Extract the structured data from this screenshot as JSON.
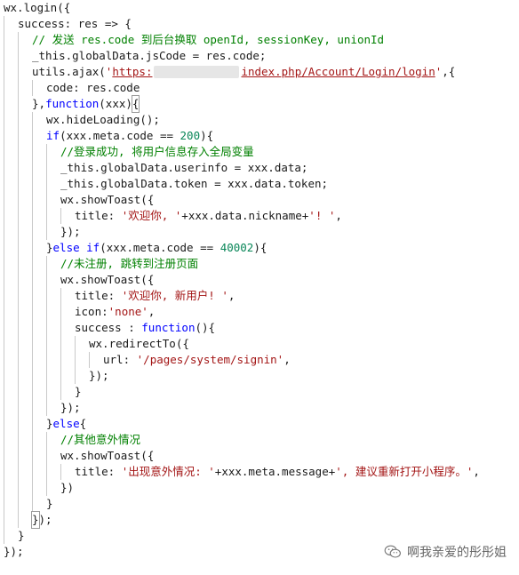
{
  "code_lines": [
    {
      "indent": 0,
      "tokens": [
        {
          "t": "wx.login({",
          "c": "plain"
        }
      ]
    },
    {
      "indent": 1,
      "tokens": [
        {
          "t": "success: res => {",
          "c": "plain"
        }
      ]
    },
    {
      "indent": 2,
      "tokens": [
        {
          "t": "// 发送 res.code 到后台换取 openId, sessionKey, unionId",
          "c": "com"
        }
      ]
    },
    {
      "indent": 2,
      "tokens": [
        {
          "t": "_this.globalData.jsCode = res.code;",
          "c": "plain"
        }
      ]
    },
    {
      "indent": 2,
      "tokens": [
        {
          "t": "utils.ajax(",
          "c": "plain"
        },
        {
          "t": "'",
          "c": "str"
        },
        {
          "t": "https:",
          "c": "link"
        },
        {
          "t": "",
          "c": "blur"
        },
        {
          "t": "index.php/Account/Login/login",
          "c": "link"
        },
        {
          "t": "'",
          "c": "str"
        },
        {
          "t": ",{",
          "c": "plain"
        }
      ]
    },
    {
      "indent": 3,
      "tokens": [
        {
          "t": "code: res.code",
          "c": "plain"
        }
      ]
    },
    {
      "indent": 2,
      "tokens": [
        {
          "t": "},",
          "c": "plain"
        },
        {
          "t": "function",
          "c": "kw"
        },
        {
          "t": "(xxx)",
          "c": "plain"
        },
        {
          "t": "{",
          "c": "bracket"
        }
      ]
    },
    {
      "indent": 3,
      "tokens": [
        {
          "t": "wx.hideLoading();",
          "c": "plain"
        }
      ]
    },
    {
      "indent": 3,
      "tokens": [
        {
          "t": "if",
          "c": "kw"
        },
        {
          "t": "(xxx.meta.code == ",
          "c": "plain"
        },
        {
          "t": "200",
          "c": "num"
        },
        {
          "t": "){",
          "c": "plain"
        }
      ]
    },
    {
      "indent": 4,
      "tokens": [
        {
          "t": "//登录成功, 将用户信息存入全局变量",
          "c": "com"
        }
      ]
    },
    {
      "indent": 4,
      "tokens": [
        {
          "t": "_this.globalData.userinfo = xxx.data;",
          "c": "plain"
        }
      ]
    },
    {
      "indent": 4,
      "tokens": [
        {
          "t": "_this.globalData.token = xxx.data.token;",
          "c": "plain"
        }
      ]
    },
    {
      "indent": 4,
      "tokens": [
        {
          "t": "wx.showToast({",
          "c": "plain"
        }
      ]
    },
    {
      "indent": 5,
      "tokens": [
        {
          "t": "title: ",
          "c": "plain"
        },
        {
          "t": "'欢迎你, '",
          "c": "str"
        },
        {
          "t": "+xxx.data.nickname+",
          "c": "plain"
        },
        {
          "t": "'! '",
          "c": "str"
        },
        {
          "t": ",",
          "c": "plain"
        }
      ]
    },
    {
      "indent": 4,
      "tokens": [
        {
          "t": "});",
          "c": "plain"
        }
      ]
    },
    {
      "indent": 3,
      "tokens": [
        {
          "t": "}",
          "c": "plain"
        },
        {
          "t": "else if",
          "c": "kw"
        },
        {
          "t": "(xxx.meta.code == ",
          "c": "plain"
        },
        {
          "t": "40002",
          "c": "num"
        },
        {
          "t": "){",
          "c": "plain"
        }
      ]
    },
    {
      "indent": 4,
      "tokens": [
        {
          "t": "//未注册, 跳转到注册页面",
          "c": "com"
        }
      ]
    },
    {
      "indent": 4,
      "tokens": [
        {
          "t": "wx.showToast({",
          "c": "plain"
        }
      ]
    },
    {
      "indent": 5,
      "tokens": [
        {
          "t": "title: ",
          "c": "plain"
        },
        {
          "t": "'欢迎你, 新用户! '",
          "c": "str"
        },
        {
          "t": ",",
          "c": "plain"
        }
      ]
    },
    {
      "indent": 5,
      "tokens": [
        {
          "t": "icon:",
          "c": "plain"
        },
        {
          "t": "'none'",
          "c": "str"
        },
        {
          "t": ",",
          "c": "plain"
        }
      ]
    },
    {
      "indent": 5,
      "tokens": [
        {
          "t": "success : ",
          "c": "plain"
        },
        {
          "t": "function",
          "c": "kw"
        },
        {
          "t": "(){",
          "c": "plain"
        }
      ]
    },
    {
      "indent": 6,
      "tokens": [
        {
          "t": "wx.redirectTo({",
          "c": "plain"
        }
      ]
    },
    {
      "indent": 7,
      "tokens": [
        {
          "t": "url: ",
          "c": "plain"
        },
        {
          "t": "'/pages/system/signin'",
          "c": "str"
        },
        {
          "t": ",",
          "c": "plain"
        }
      ]
    },
    {
      "indent": 6,
      "tokens": [
        {
          "t": "});",
          "c": "plain"
        }
      ]
    },
    {
      "indent": 5,
      "tokens": [
        {
          "t": "}",
          "c": "plain"
        }
      ]
    },
    {
      "indent": 4,
      "tokens": [
        {
          "t": "});",
          "c": "plain"
        }
      ]
    },
    {
      "indent": 3,
      "tokens": [
        {
          "t": "}",
          "c": "plain"
        },
        {
          "t": "else",
          "c": "kw"
        },
        {
          "t": "{",
          "c": "plain"
        }
      ]
    },
    {
      "indent": 4,
      "tokens": [
        {
          "t": "//其他意外情况",
          "c": "com"
        }
      ]
    },
    {
      "indent": 4,
      "tokens": [
        {
          "t": "wx.showToast({",
          "c": "plain"
        }
      ]
    },
    {
      "indent": 5,
      "tokens": [
        {
          "t": "title: ",
          "c": "plain"
        },
        {
          "t": "'出现意外情况: '",
          "c": "str"
        },
        {
          "t": "+xxx.meta.message+",
          "c": "plain"
        },
        {
          "t": "', 建议重新打开小程序。'",
          "c": "str"
        },
        {
          "t": ",",
          "c": "plain"
        }
      ]
    },
    {
      "indent": 4,
      "tokens": [
        {
          "t": "})",
          "c": "plain"
        }
      ]
    },
    {
      "indent": 3,
      "tokens": [
        {
          "t": "}",
          "c": "plain"
        }
      ]
    },
    {
      "indent": 2,
      "tokens": [
        {
          "t": "}",
          "c": "bracket"
        },
        {
          "t": ");",
          "c": "plain"
        }
      ]
    },
    {
      "indent": 1,
      "tokens": [
        {
          "t": "}",
          "c": "plain"
        }
      ]
    },
    {
      "indent": 0,
      "tokens": [
        {
          "t": "});",
          "c": "plain"
        }
      ]
    }
  ],
  "watermark": {
    "text": "啊我亲爱的彤彤姐",
    "icon": "wechat-icon"
  },
  "colors": {
    "keyword": "#0000ff",
    "string": "#a31515",
    "number": "#098658",
    "comment": "#008000",
    "text": "#1a1a1a"
  }
}
